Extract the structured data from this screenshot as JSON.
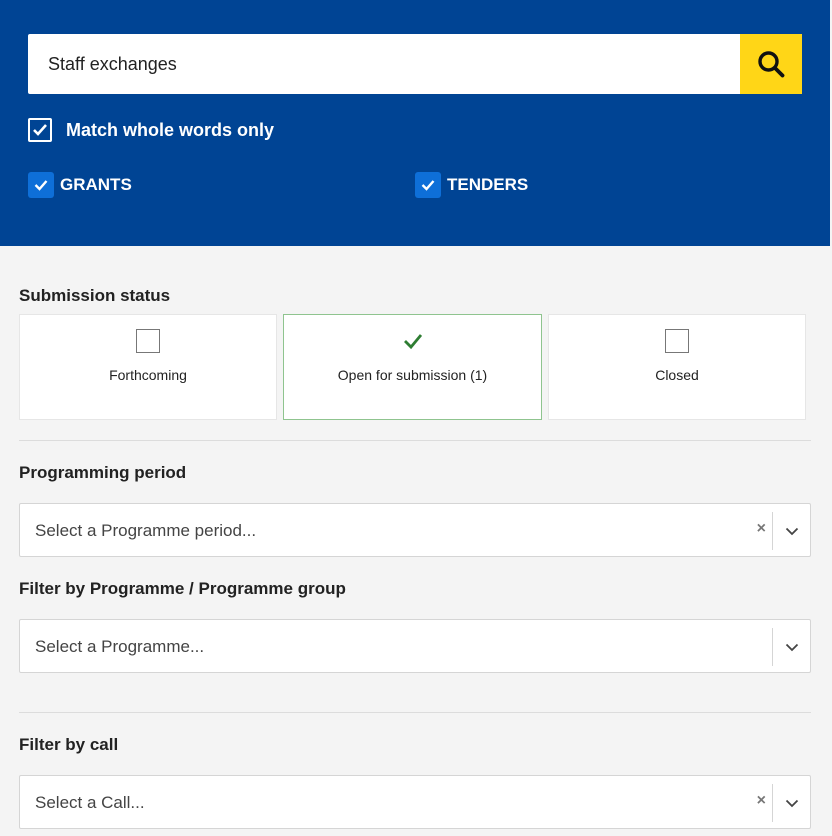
{
  "search": {
    "query": "Staff exchanges",
    "match_whole_words_label": "Match whole words only",
    "match_whole_words_checked": true
  },
  "type_filters": [
    {
      "label": "GRANTS",
      "checked": true
    },
    {
      "label": "TENDERS",
      "checked": true
    }
  ],
  "submission_status": {
    "heading": "Submission status",
    "options": [
      {
        "label": "Forthcoming",
        "selected": false
      },
      {
        "label": "Open for submission (1)",
        "selected": true
      },
      {
        "label": "Closed",
        "selected": false
      }
    ]
  },
  "programming_period": {
    "heading": "Programming period",
    "placeholder": "Select a Programme period..."
  },
  "programme_filter": {
    "heading": "Filter by Programme / Programme group",
    "placeholder": "Select a Programme..."
  },
  "call_filter": {
    "heading": "Filter by call",
    "placeholder": "Select a Call..."
  },
  "colors": {
    "header_bg": "#004494",
    "search_button": "#ffd617",
    "checkbox_blue": "#0e6fd8",
    "selected_check": "#2e7d32"
  }
}
